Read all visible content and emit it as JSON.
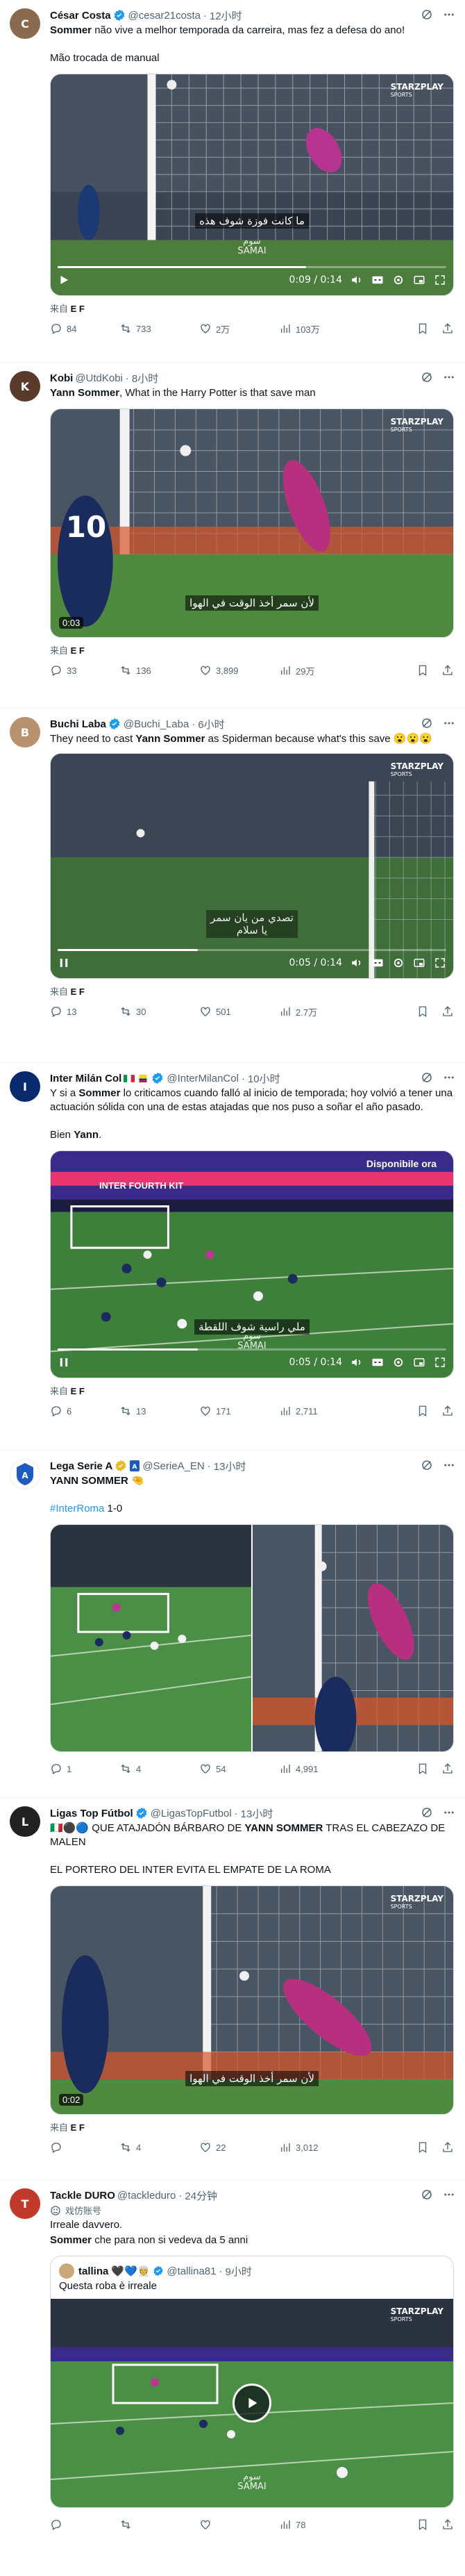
{
  "tweets": [
    {
      "name": "César Costa",
      "handle": "@cesar21costa",
      "time": "12小时",
      "text_bold": "Sommer",
      "text_rest": " não vive a melhor temporada da carreira, mas fez a defesa do ano!",
      "text2": "Mão trocada de manual",
      "video": {
        "time": "0:09 / 0:14",
        "progress": 0.64,
        "subtitle": "ما كانت فوزة شوف هذه",
        "watermark_top": "سوم",
        "watermark_bottom": "SAMAI",
        "logo": "STARZPLAY",
        "logo_sub": "SPORTS"
      },
      "source_label": "来自",
      "source": "E F",
      "replies": "84",
      "retweets": "733",
      "likes": "2万",
      "views": "103万",
      "avatar_color": "#8a6a4f",
      "avatar_letter": "C"
    },
    {
      "name": "Kobi",
      "handle": "@UtdKobi",
      "time": "8小时",
      "text_bold": "Yann Sommer",
      "text_rest": ", What in the Harry Potter is that save man",
      "video": {
        "duration": "0:03",
        "subtitle": "لأن سمر أخذ الوقت في الهوا",
        "logo": "STARZPLAY",
        "logo_sub": "SPORTS"
      },
      "source_label": "来自",
      "source": "E F",
      "replies": "33",
      "retweets": "136",
      "likes": "3,899",
      "views": "29万",
      "avatar_color": "#5a3a2a",
      "avatar_letter": "K"
    },
    {
      "name": "Buchi Laba",
      "handle": "@Buchi_Laba",
      "time": "6小时",
      "text_pre": "They need to cast ",
      "text_bold": "Yann Sommer",
      "text_rest": " as Spiderman because what's this save",
      "emoji": "😮😮😮",
      "video": {
        "time": "0:05 / 0:14",
        "progress": 0.36,
        "subtitle_line1": "تصدي من يان سمر",
        "subtitle_line2": "يا سلام",
        "logo": "STARZPLAY",
        "logo_sub": "SPORTS"
      },
      "source_label": "来自",
      "source": "E F",
      "replies": "13",
      "retweets": "30",
      "likes": "501",
      "views": "2.7万",
      "avatar_color": "#b8926f",
      "avatar_letter": "B"
    },
    {
      "name": "Inter Milán Col",
      "handle": "@InterMilanCol",
      "time": "10小时",
      "text_pre": "Y si a ",
      "text_bold": "Sommer",
      "text_rest": " lo criticamos cuando falló al inicio de temporada; hoy volvió a tener una actuación sólida con una de estas atajadas que nos puso a soñar el año pasado.",
      "text2_pre": "Bien ",
      "text2_bold": "Yann",
      "text2_rest": ".",
      "video": {
        "time": "0:05 / 0:14",
        "progress": 0.36,
        "subtitle": "ملي راسية شوف اللقطة",
        "watermark_top": "سوم",
        "watermark_bottom": "SAMAI",
        "banner1": "INTER FOURTH KIT",
        "banner2": "Disponibile ora"
      },
      "source_label": "来自",
      "source": "E F",
      "replies": "6",
      "retweets": "13",
      "likes": "171",
      "views": "2,711",
      "avatar_color": "#0a2a6e",
      "avatar_letter": "I"
    },
    {
      "name": "Lega Serie A",
      "handle": "@SerieA_EN",
      "time": "13小时",
      "text_bold": "YANN SOMMER",
      "text_rest": " 🤏",
      "hashtag": "#InterRoma",
      "score": " 1-0",
      "replies": "1",
      "retweets": "4",
      "likes": "54",
      "views": "4,991",
      "avatar_color": "#1d5bbf",
      "avatar_letter": "A"
    },
    {
      "name": "Ligas Top Fútbol",
      "handle": "@LigasTopFutbol",
      "time": "13小时",
      "text_pre": "🇮🇹⚫🔵 QUE ATAJADÓN BÁRBARO DE ",
      "text_bold": "YANN SOMMER",
      "text_rest": " TRAS EL CABEZAZO DE MALEN",
      "text2": "EL PORTERO DEL INTER EVITA EL EMPATE DE LA ROMA",
      "video": {
        "duration": "0:02",
        "subtitle": "لأن سمر أخذ الوقت في الهوا",
        "logo": "STARZPLAY",
        "logo_sub": "SPORTS"
      },
      "source_label": "来自",
      "source": "E F",
      "replies": "",
      "retweets": "4",
      "likes": "22",
      "views": "3,012",
      "avatar_color": "#222222",
      "avatar_letter": "L"
    },
    {
      "name": "Tackle DURO",
      "handle": "@tackleduro",
      "time": "24分钟",
      "parody": "戏仿账号",
      "text": "Irreale davvero.",
      "text2_bold": "Sommer",
      "text2_rest": " che para non si vedeva da 5 anni",
      "quote": {
        "name": "tallina",
        "emojis": "🖤💙👳",
        "handle": "@tallina81",
        "time": "9小时",
        "text": "Questa roba è irreale"
      },
      "video": {
        "watermark_top": "سوم",
        "watermark_bottom": "SAMAI",
        "logo": "STARZPLAY",
        "logo_sub": "SPORTS"
      },
      "replies": "",
      "retweets": "",
      "likes": "",
      "views": "78",
      "avatar_color": "#c0392b",
      "avatar_letter": "T"
    }
  ],
  "colors": {
    "verified_blue": "#1d9bf0",
    "verified_gold": "#e8b923",
    "link": "#1d9bf0",
    "muted": "#536471"
  }
}
